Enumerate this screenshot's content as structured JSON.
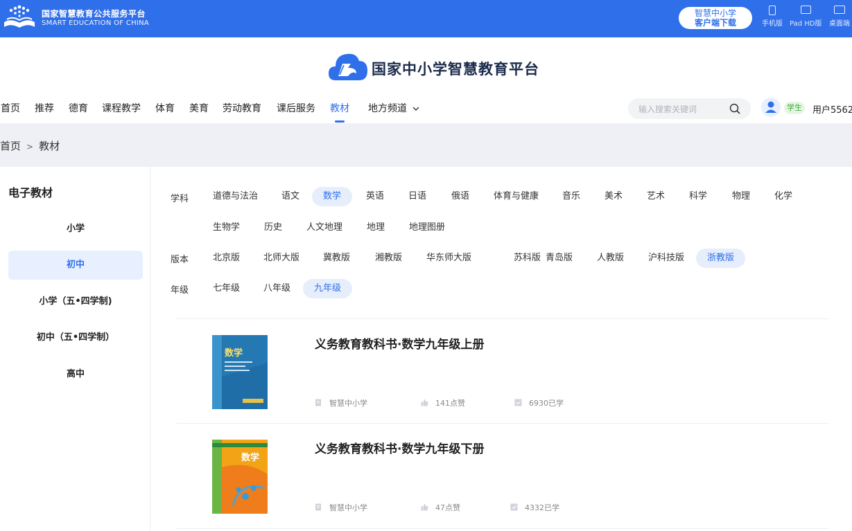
{
  "topbar": {
    "brand_cn": "国家智慧教育公共服务平台",
    "brand_en": "SMART EDUCATION OF CHINA",
    "download_line1": "智慧中小学",
    "download_line2": "客户端下载",
    "devices": [
      "手机版",
      "Pad HD版",
      "桌面端"
    ]
  },
  "header": {
    "site_title": "国家中小学智慧教育平台",
    "nav": [
      "首页",
      "推荐",
      "德育",
      "课程教学",
      "体育",
      "美育",
      "劳动教育",
      "课后服务",
      "教材",
      "地方频道"
    ],
    "active_nav": "教材",
    "search_placeholder": "输入搜索关键词",
    "role_badge": "学生",
    "username": "用户5562"
  },
  "breadcrumb": {
    "home": "首页",
    "sep": ">",
    "current": "教材"
  },
  "sidebar": {
    "title": "电子教材",
    "items": [
      "小学",
      "初中",
      "小学（五•四学制)",
      "初中（五•四学制）",
      "高中"
    ],
    "active": "初中"
  },
  "filters": {
    "subject_label": "学科",
    "subjects_row1": [
      "道德与法治",
      "语文",
      "数学",
      "英语",
      "日语",
      "俄语",
      "体育与健康",
      "音乐",
      "美术",
      "艺术",
      "科学",
      "物理",
      "化学"
    ],
    "subjects_row2": [
      "生物学",
      "历史",
      "人文地理",
      "地理",
      "地理图册"
    ],
    "subject_selected": "数学",
    "edition_label": "版本",
    "editions": [
      "北京版",
      "北师大版",
      "冀教版",
      "湘教版",
      "华东师大版",
      "苏科版",
      "青岛版",
      "人教版",
      "沪科技版",
      "浙教版"
    ],
    "edition_selected": "浙教版",
    "grade_label": "年级",
    "grades": [
      "七年级",
      "八年级",
      "九年级"
    ],
    "grade_selected": "九年级"
  },
  "books": [
    {
      "title": "义务教育教科书·数学九年级上册",
      "publisher": "智慧中小学",
      "likes": "141点赞",
      "studied": "6930已学",
      "cover_title": "数学"
    },
    {
      "title": "义务教育教科书·数学九年级下册",
      "publisher": "智慧中小学",
      "likes": "47点赞",
      "studied": "4332已学",
      "cover_title": "数学"
    }
  ],
  "colors": {
    "brand": "#2f6fea",
    "selected_bg": "#e6eefc",
    "role_bg": "#e6f6e1"
  },
  "icons": [
    "logo-book-icon",
    "phone-icon",
    "tablet-icon",
    "desktop-icon",
    "cloud-logo-icon",
    "search-icon",
    "user-icon",
    "chevron-down-icon",
    "publisher-icon",
    "like-icon",
    "study-icon"
  ]
}
